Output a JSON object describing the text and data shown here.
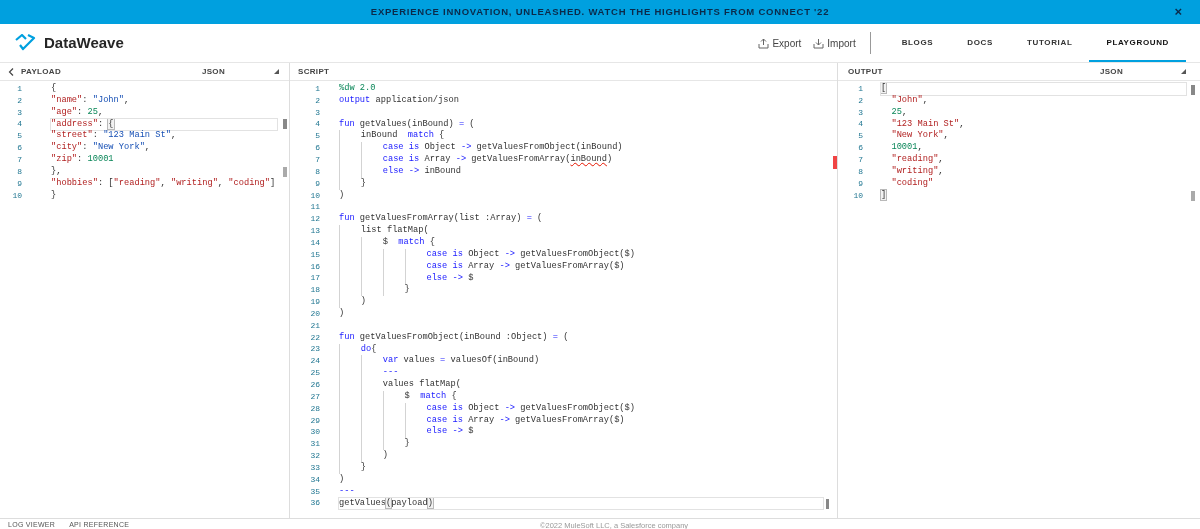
{
  "banner": {
    "text": "EXPERIENCE INNOVATION, UNLEASHED. WATCH THE HIGHLIGHTS FROM CONNECT '22",
    "close": "×"
  },
  "header": {
    "brand": "DataWeave",
    "actions": [
      "Export",
      "Import"
    ],
    "nav": [
      {
        "label": "BLOGS",
        "selected": false
      },
      {
        "label": "DOCS",
        "selected": false
      },
      {
        "label": "TUTORIAL",
        "selected": false
      },
      {
        "label": "PLAYGROUND",
        "selected": true
      }
    ]
  },
  "payload": {
    "title": "PAYLOAD",
    "format": "JSON",
    "lines": [
      {
        "number": "1",
        "highlighted": false,
        "tokens": [
          {
            "kind": "plain",
            "text": "{"
          }
        ]
      },
      {
        "number": "2",
        "highlighted": false,
        "tokens": [
          {
            "kind": "literal",
            "text": "\"name\""
          },
          {
            "kind": "plain",
            "text": ": "
          },
          {
            "kind": "string",
            "text": "\"John\""
          },
          {
            "kind": "plain",
            "text": ","
          }
        ]
      },
      {
        "number": "3",
        "highlighted": false,
        "tokens": [
          {
            "kind": "literal",
            "text": "\"age\""
          },
          {
            "kind": "plain",
            "text": ": "
          },
          {
            "kind": "number",
            "text": "25"
          },
          {
            "kind": "plain",
            "text": ","
          }
        ]
      },
      {
        "number": "4",
        "highlighted": true,
        "tokens": [
          {
            "kind": "literal",
            "text": "\"address\""
          },
          {
            "kind": "plain",
            "text": ": "
          },
          {
            "kind": "bracket",
            "text": "{"
          }
        ]
      },
      {
        "number": "5",
        "highlighted": false,
        "tokens": [
          {
            "kind": "literal",
            "text": "\"street\""
          },
          {
            "kind": "plain",
            "text": ": "
          },
          {
            "kind": "string",
            "text": "\"123 Main St\""
          },
          {
            "kind": "plain",
            "text": ","
          }
        ]
      },
      {
        "number": "6",
        "highlighted": false,
        "tokens": [
          {
            "kind": "literal",
            "text": "\"city\""
          },
          {
            "kind": "plain",
            "text": ": "
          },
          {
            "kind": "string",
            "text": "\"New York\""
          },
          {
            "kind": "plain",
            "text": ","
          }
        ]
      },
      {
        "number": "7",
        "highlighted": false,
        "tokens": [
          {
            "kind": "literal",
            "text": "\"zip\""
          },
          {
            "kind": "plain",
            "text": ": "
          },
          {
            "kind": "number",
            "text": "10001"
          }
        ]
      },
      {
        "number": "8",
        "highlighted": false,
        "tokens": [
          {
            "kind": "plain",
            "text": "},"
          }
        ]
      },
      {
        "number": "9",
        "highlighted": false,
        "tokens": [
          {
            "kind": "literal",
            "text": "\"hobbies\""
          },
          {
            "kind": "plain",
            "text": ": ["
          },
          {
            "kind": "literal",
            "text": "\"reading\""
          },
          {
            "kind": "plain",
            "text": ", "
          },
          {
            "kind": "literal",
            "text": "\"writing\""
          },
          {
            "kind": "plain",
            "text": ", "
          },
          {
            "kind": "literal",
            "text": "\"coding\""
          },
          {
            "kind": "plain",
            "text": "]"
          }
        ]
      },
      {
        "number": "10",
        "highlighted": false,
        "tokens": [
          {
            "kind": "plain",
            "text": "}"
          }
        ]
      }
    ]
  },
  "script": {
    "title": "SCRIPT",
    "lines": [
      {
        "number": "1",
        "highlighted": false,
        "tokens": [
          {
            "kind": "number",
            "text": "%dw 2.0"
          }
        ]
      },
      {
        "number": "2",
        "highlighted": false,
        "tokens": [
          {
            "kind": "keyword",
            "text": "output"
          },
          {
            "kind": "plain",
            "text": " application/json"
          }
        ]
      },
      {
        "number": "3",
        "highlighted": false
      },
      {
        "number": "4",
        "highlighted": false,
        "tokens": [
          {
            "kind": "keyword",
            "text": "fun"
          },
          {
            "kind": "plain",
            "text": " getValues(inBound) "
          },
          {
            "kind": "keyword",
            "text": "="
          },
          {
            "kind": "plain",
            "text": " ("
          }
        ]
      },
      {
        "number": "5",
        "highlighted": false,
        "tokens": [
          {
            "kind": "plain",
            "text": "    inBound  "
          },
          {
            "kind": "keyword",
            "text": "match"
          },
          {
            "kind": "plain",
            "text": " {"
          }
        ]
      },
      {
        "number": "6",
        "highlighted": false,
        "tokens": [
          {
            "kind": "keyword",
            "text": "        case is"
          },
          {
            "kind": "plain",
            "text": " Object "
          },
          {
            "kind": "keyword",
            "text": "->"
          },
          {
            "kind": "plain",
            "text": " getValuesFromObject(inBound)"
          }
        ]
      },
      {
        "number": "7",
        "highlighted": false,
        "tokens": [
          {
            "kind": "keyword",
            "text": "        case is"
          },
          {
            "kind": "plain",
            "text": " Array "
          },
          {
            "kind": "keyword",
            "text": "->"
          },
          {
            "kind": "plain",
            "text": " getValuesFromArray("
          },
          {
            "kind": "error",
            "text": "inBound"
          },
          {
            "kind": "plain",
            "text": ")"
          }
        ]
      },
      {
        "number": "8",
        "highlighted": false,
        "tokens": [
          {
            "kind": "keyword",
            "text": "        else ->"
          },
          {
            "kind": "plain",
            "text": " inBound"
          }
        ]
      },
      {
        "number": "9",
        "highlighted": false,
        "tokens": [
          {
            "kind": "plain",
            "text": "    }"
          }
        ]
      },
      {
        "number": "10",
        "highlighted": false,
        "tokens": [
          {
            "kind": "plain",
            "text": ")"
          }
        ]
      },
      {
        "number": "11",
        "highlighted": false
      },
      {
        "number": "12",
        "highlighted": false,
        "tokens": [
          {
            "kind": "keyword",
            "text": "fun"
          },
          {
            "kind": "plain",
            "text": " getValuesFromArray(list :Array) "
          },
          {
            "kind": "keyword",
            "text": "="
          },
          {
            "kind": "plain",
            "text": " ("
          }
        ]
      },
      {
        "number": "13",
        "highlighted": false,
        "tokens": [
          {
            "kind": "plain",
            "text": "    list flatMap("
          }
        ]
      },
      {
        "number": "14",
        "highlighted": false,
        "tokens": [
          {
            "kind": "plain",
            "text": "        $  "
          },
          {
            "kind": "keyword",
            "text": "match"
          },
          {
            "kind": "plain",
            "text": " {"
          }
        ]
      },
      {
        "number": "15",
        "highlighted": false,
        "tokens": [
          {
            "kind": "keyword",
            "text": "                case is"
          },
          {
            "kind": "plain",
            "text": " Object "
          },
          {
            "kind": "keyword",
            "text": "->"
          },
          {
            "kind": "plain",
            "text": " getValuesFromObject($)"
          }
        ]
      },
      {
        "number": "16",
        "highlighted": false,
        "tokens": [
          {
            "kind": "keyword",
            "text": "                case is"
          },
          {
            "kind": "plain",
            "text": " Array "
          },
          {
            "kind": "keyword",
            "text": "->"
          },
          {
            "kind": "plain",
            "text": " getValuesFromArray($)"
          }
        ]
      },
      {
        "number": "17",
        "highlighted": false,
        "tokens": [
          {
            "kind": "keyword",
            "text": "                else ->"
          },
          {
            "kind": "plain",
            "text": " $"
          }
        ]
      },
      {
        "number": "18",
        "highlighted": false,
        "tokens": [
          {
            "kind": "plain",
            "text": "            }"
          }
        ]
      },
      {
        "number": "19",
        "highlighted": false,
        "tokens": [
          {
            "kind": "plain",
            "text": "    )"
          }
        ]
      },
      {
        "number": "20",
        "highlighted": false,
        "tokens": [
          {
            "kind": "plain",
            "text": ")"
          }
        ]
      },
      {
        "number": "21",
        "highlighted": false
      },
      {
        "number": "22",
        "highlighted": false,
        "tokens": [
          {
            "kind": "keyword",
            "text": "fun"
          },
          {
            "kind": "plain",
            "text": " getValuesFromObject(inBound :Object) "
          },
          {
            "kind": "keyword",
            "text": "="
          },
          {
            "kind": "plain",
            "text": " ("
          }
        ]
      },
      {
        "number": "23",
        "highlighted": false,
        "tokens": [
          {
            "kind": "keyword",
            "text": "    do"
          },
          {
            "kind": "plain",
            "text": "{"
          }
        ]
      },
      {
        "number": "24",
        "highlighted": false,
        "tokens": [
          {
            "kind": "keyword",
            "text": "        var"
          },
          {
            "kind": "plain",
            "text": " values "
          },
          {
            "kind": "keyword",
            "text": "="
          },
          {
            "kind": "plain",
            "text": " valuesOf(inBound)"
          }
        ]
      },
      {
        "number": "25",
        "highlighted": false,
        "tokens": [
          {
            "kind": "keyword",
            "text": "        ---"
          }
        ]
      },
      {
        "number": "26",
        "highlighted": false,
        "tokens": [
          {
            "kind": "plain",
            "text": "        values flatMap("
          }
        ]
      },
      {
        "number": "27",
        "highlighted": false,
        "tokens": [
          {
            "kind": "plain",
            "text": "            $  "
          },
          {
            "kind": "keyword",
            "text": "match"
          },
          {
            "kind": "plain",
            "text": " {"
          }
        ]
      },
      {
        "number": "28",
        "highlighted": false,
        "tokens": [
          {
            "kind": "keyword",
            "text": "                case is"
          },
          {
            "kind": "plain",
            "text": " Object "
          },
          {
            "kind": "keyword",
            "text": "->"
          },
          {
            "kind": "plain",
            "text": " getValuesFromObject($)"
          }
        ]
      },
      {
        "number": "29",
        "highlighted": false,
        "tokens": [
          {
            "kind": "keyword",
            "text": "                case is"
          },
          {
            "kind": "plain",
            "text": " Array "
          },
          {
            "kind": "keyword",
            "text": "->"
          },
          {
            "kind": "plain",
            "text": " getValuesFromArray($)"
          }
        ]
      },
      {
        "number": "30",
        "highlighted": false,
        "tokens": [
          {
            "kind": "keyword",
            "text": "                else ->"
          },
          {
            "kind": "plain",
            "text": " $"
          }
        ]
      },
      {
        "number": "31",
        "highlighted": false,
        "tokens": [
          {
            "kind": "plain",
            "text": "            }"
          }
        ]
      },
      {
        "number": "32",
        "highlighted": false,
        "tokens": [
          {
            "kind": "plain",
            "text": "        )"
          }
        ]
      },
      {
        "number": "33",
        "highlighted": false,
        "tokens": [
          {
            "kind": "plain",
            "text": "    }"
          }
        ]
      },
      {
        "number": "34",
        "highlighted": false,
        "tokens": [
          {
            "kind": "plain",
            "text": ")"
          }
        ]
      },
      {
        "number": "35",
        "highlighted": false,
        "tokens": [
          {
            "kind": "keyword",
            "text": "---"
          }
        ]
      },
      {
        "number": "36",
        "highlighted": true,
        "tokens": [
          {
            "kind": "plain",
            "text": "getValues"
          },
          {
            "kind": "bracket",
            "text": "("
          },
          {
            "kind": "plain",
            "text": "payload"
          },
          {
            "kind": "bracket",
            "text": ")"
          }
        ]
      }
    ]
  },
  "output": {
    "title": "OUTPUT",
    "format": "JSON",
    "lines": [
      {
        "number": "1",
        "highlighted": true,
        "tokens": [
          {
            "kind": "bracket",
            "text": "["
          }
        ]
      },
      {
        "number": "2",
        "highlighted": false,
        "tokens": [
          {
            "kind": "literal",
            "text": "  \"John\""
          },
          {
            "kind": "plain",
            "text": ","
          }
        ]
      },
      {
        "number": "3",
        "highlighted": false,
        "tokens": [
          {
            "kind": "number",
            "text": "  25"
          },
          {
            "kind": "plain",
            "text": ","
          }
        ]
      },
      {
        "number": "4",
        "highlighted": false,
        "tokens": [
          {
            "kind": "literal",
            "text": "  \"123 Main St\""
          },
          {
            "kind": "plain",
            "text": ","
          }
        ]
      },
      {
        "number": "5",
        "highlighted": false,
        "tokens": [
          {
            "kind": "literal",
            "text": "  \"New York\""
          },
          {
            "kind": "plain",
            "text": ","
          }
        ]
      },
      {
        "number": "6",
        "highlighted": false,
        "tokens": [
          {
            "kind": "number",
            "text": "  10001"
          },
          {
            "kind": "plain",
            "text": ","
          }
        ]
      },
      {
        "number": "7",
        "highlighted": false,
        "tokens": [
          {
            "kind": "literal",
            "text": "  \"reading\""
          },
          {
            "kind": "plain",
            "text": ","
          }
        ]
      },
      {
        "number": "8",
        "highlighted": false,
        "tokens": [
          {
            "kind": "literal",
            "text": "  \"writing\""
          },
          {
            "kind": "plain",
            "text": ","
          }
        ]
      },
      {
        "number": "9",
        "highlighted": false,
        "tokens": [
          {
            "kind": "literal",
            "text": "  \"coding\""
          }
        ]
      },
      {
        "number": "10",
        "highlighted": false,
        "tokens": [
          {
            "kind": "bracket",
            "text": "]"
          }
        ]
      }
    ]
  },
  "footer": {
    "links": [
      "LOG VIEWER",
      "API REFERENCE"
    ],
    "copyright": "©2022 MuleSoft LLC, a Salesforce company"
  }
}
